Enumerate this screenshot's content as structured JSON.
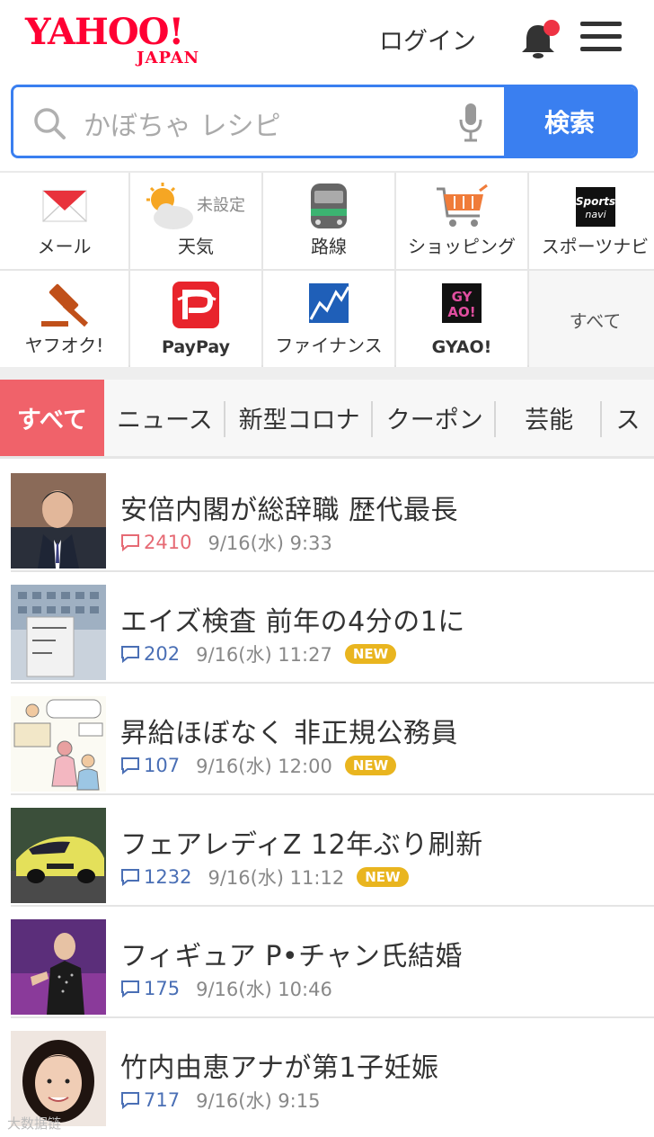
{
  "header": {
    "logo_main": "YAHOO!",
    "logo_sub": "JAPAN",
    "login": "ログイン",
    "bell_icon": "bell-icon",
    "menu_icon": "hamburger-menu-icon"
  },
  "search": {
    "placeholder": "かぼちゃ レシピ",
    "button": "検索"
  },
  "services": [
    {
      "label": "メール",
      "icon": "mail-icon"
    },
    {
      "label": "天気",
      "icon": "weather-icon",
      "badge": "未設定"
    },
    {
      "label": "路線",
      "icon": "train-icon"
    },
    {
      "label": "ショッピング",
      "icon": "cart-icon"
    },
    {
      "label": "スポーツナビ",
      "icon": "sportsnavi-icon"
    },
    {
      "label": "ヤフオク!",
      "icon": "auction-gavel-icon"
    },
    {
      "label": "PayPay",
      "icon": "paypay-icon"
    },
    {
      "label": "ファイナンス",
      "icon": "finance-chart-icon"
    },
    {
      "label": "GYAO!",
      "icon": "gyao-icon"
    },
    {
      "label": "すべて"
    }
  ],
  "tabs": [
    "すべて",
    "ニュース",
    "新型コロナ",
    "クーポン",
    "芸能",
    "ス"
  ],
  "news": [
    {
      "title": "安倍内閣が総辞職 歴代最長",
      "comments": "2410",
      "date": "9/16(水) 9:33",
      "new": false,
      "hot": true
    },
    {
      "title": "エイズ検査 前年の4分の1に",
      "comments": "202",
      "date": "9/16(水) 11:27",
      "new": true
    },
    {
      "title": "昇給ほぼなく 非正規公務員",
      "comments": "107",
      "date": "9/16(水) 12:00",
      "new": true
    },
    {
      "title": "フェアレディZ 12年ぶり刷新",
      "comments": "1232",
      "date": "9/16(水) 11:12",
      "new": true
    },
    {
      "title": "フィギュア P•チャン氏結婚",
      "comments": "175",
      "date": "9/16(水) 10:46",
      "new": false
    },
    {
      "title": "竹内由恵アナが第1子妊娠",
      "comments": "717",
      "date": "9/16(水) 9:15",
      "new": false
    }
  ],
  "new_badge": "NEW",
  "watermark": "大数据链"
}
